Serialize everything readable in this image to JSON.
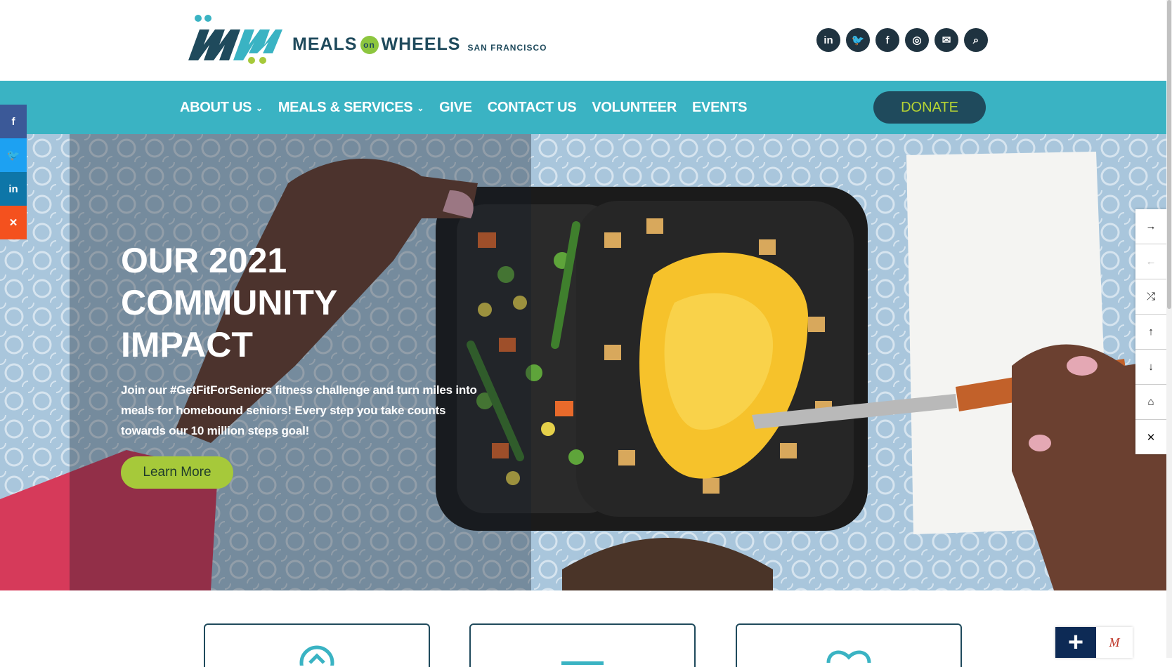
{
  "brand": {
    "name_meals": "MEALS",
    "name_on": "on",
    "name_wheels": "WHEELS",
    "name_location": "SAN FRANCISCO",
    "colors": {
      "teal": "#3ab3c3",
      "navy": "#1f4a5c",
      "lime": "#a6c93a"
    }
  },
  "social": [
    {
      "icon": "linkedin-icon",
      "glyph": "in"
    },
    {
      "icon": "twitter-icon",
      "glyph": "🐦"
    },
    {
      "icon": "facebook-icon",
      "glyph": "f"
    },
    {
      "icon": "instagram-icon",
      "glyph": "◎"
    },
    {
      "icon": "email-icon",
      "glyph": "✉"
    },
    {
      "icon": "search-icon",
      "glyph": "⌕"
    }
  ],
  "nav": {
    "items": [
      {
        "label": "ABOUT US",
        "dropdown": true
      },
      {
        "label": "MEALS & SERVICES",
        "dropdown": true
      },
      {
        "label": "GIVE",
        "dropdown": false
      },
      {
        "label": "CONTACT US",
        "dropdown": false
      },
      {
        "label": "VOLUNTEER",
        "dropdown": false
      },
      {
        "label": "EVENTS",
        "dropdown": false
      }
    ],
    "chevron": "⌄",
    "donate": "DONATE"
  },
  "hero": {
    "title_line1": "OUR 2021",
    "title_line2": "COMMUNITY",
    "title_line3": "IMPACT",
    "body": "Join our #GetFitForSeniors fitness challenge and turn miles into meals for homebound seniors! Every step you take counts towards our 10 million steps goal!",
    "button": "Learn More"
  },
  "share": [
    {
      "icon": "facebook-icon",
      "glyph": "f",
      "color": "#3b5998"
    },
    {
      "icon": "twitter-icon",
      "glyph": "🐦",
      "color": "#1da1f2"
    },
    {
      "icon": "linkedin-icon",
      "glyph": "in",
      "color": "#0e76a8"
    },
    {
      "icon": "close-icon",
      "glyph": "✕",
      "color": "#f4511e"
    }
  ],
  "controls": [
    {
      "icon": "arrow-right-icon",
      "glyph": "→",
      "dim": false
    },
    {
      "icon": "arrow-left-icon",
      "glyph": "←",
      "dim": true
    },
    {
      "icon": "shuffle-icon",
      "glyph": "⤮",
      "dim": false
    },
    {
      "icon": "arrow-up-icon",
      "glyph": "↑",
      "dim": false
    },
    {
      "icon": "arrow-down-icon",
      "glyph": "↓",
      "dim": false
    },
    {
      "icon": "home-icon",
      "glyph": "⌂",
      "dim": false
    },
    {
      "icon": "close-icon",
      "glyph": "✕",
      "dim": false
    }
  ],
  "widget": {
    "plus": "+",
    "mark": "M"
  }
}
